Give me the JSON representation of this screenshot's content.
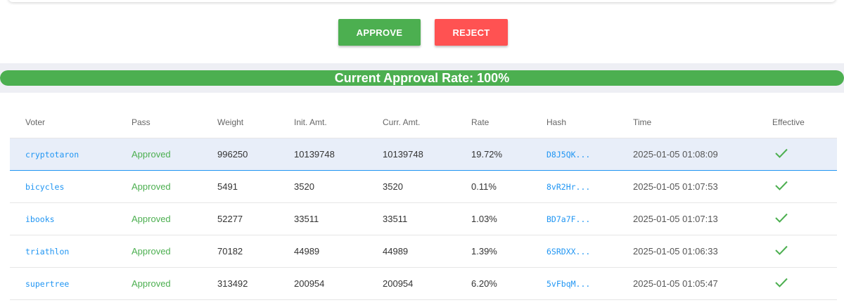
{
  "actions": {
    "approve_label": "APPROVE",
    "reject_label": "REJECT"
  },
  "approval": {
    "label": "Current Approval Rate: 100%",
    "rate": 100
  },
  "colors": {
    "approve": "#4caf50",
    "reject": "#ff5252",
    "link": "#2196f3"
  },
  "table": {
    "headers": [
      "Voter",
      "Pass",
      "Weight",
      "Init. Amt.",
      "Curr. Amt.",
      "Rate",
      "Hash",
      "Time",
      "Effective"
    ],
    "rows": [
      {
        "voter": "cryptotaron",
        "pass": "Approved",
        "weight": "996250",
        "init": "10139748",
        "curr": "10139748",
        "rate": "19.72%",
        "hash": "D8J5QK...",
        "time": "2025-01-05 01:08:09",
        "effective_icon": "check-icon"
      },
      {
        "voter": "bicycles",
        "pass": "Approved",
        "weight": "5491",
        "init": "3520",
        "curr": "3520",
        "rate": "0.11%",
        "hash": "8vR2Hr...",
        "time": "2025-01-05 01:07:53",
        "effective_icon": "check-icon"
      },
      {
        "voter": "ibooks",
        "pass": "Approved",
        "weight": "52277",
        "init": "33511",
        "curr": "33511",
        "rate": "1.03%",
        "hash": "BD7a7F...",
        "time": "2025-01-05 01:07:13",
        "effective_icon": "check-icon"
      },
      {
        "voter": "triathlon",
        "pass": "Approved",
        "weight": "70182",
        "init": "44989",
        "curr": "44989",
        "rate": "1.39%",
        "hash": "6SRDXX...",
        "time": "2025-01-05 01:06:33",
        "effective_icon": "check-icon"
      },
      {
        "voter": "supertree",
        "pass": "Approved",
        "weight": "313492",
        "init": "200954",
        "curr": "200954",
        "rate": "6.20%",
        "hash": "5vFbqM...",
        "time": "2025-01-05 01:05:47",
        "effective_icon": "check-icon"
      }
    ]
  }
}
